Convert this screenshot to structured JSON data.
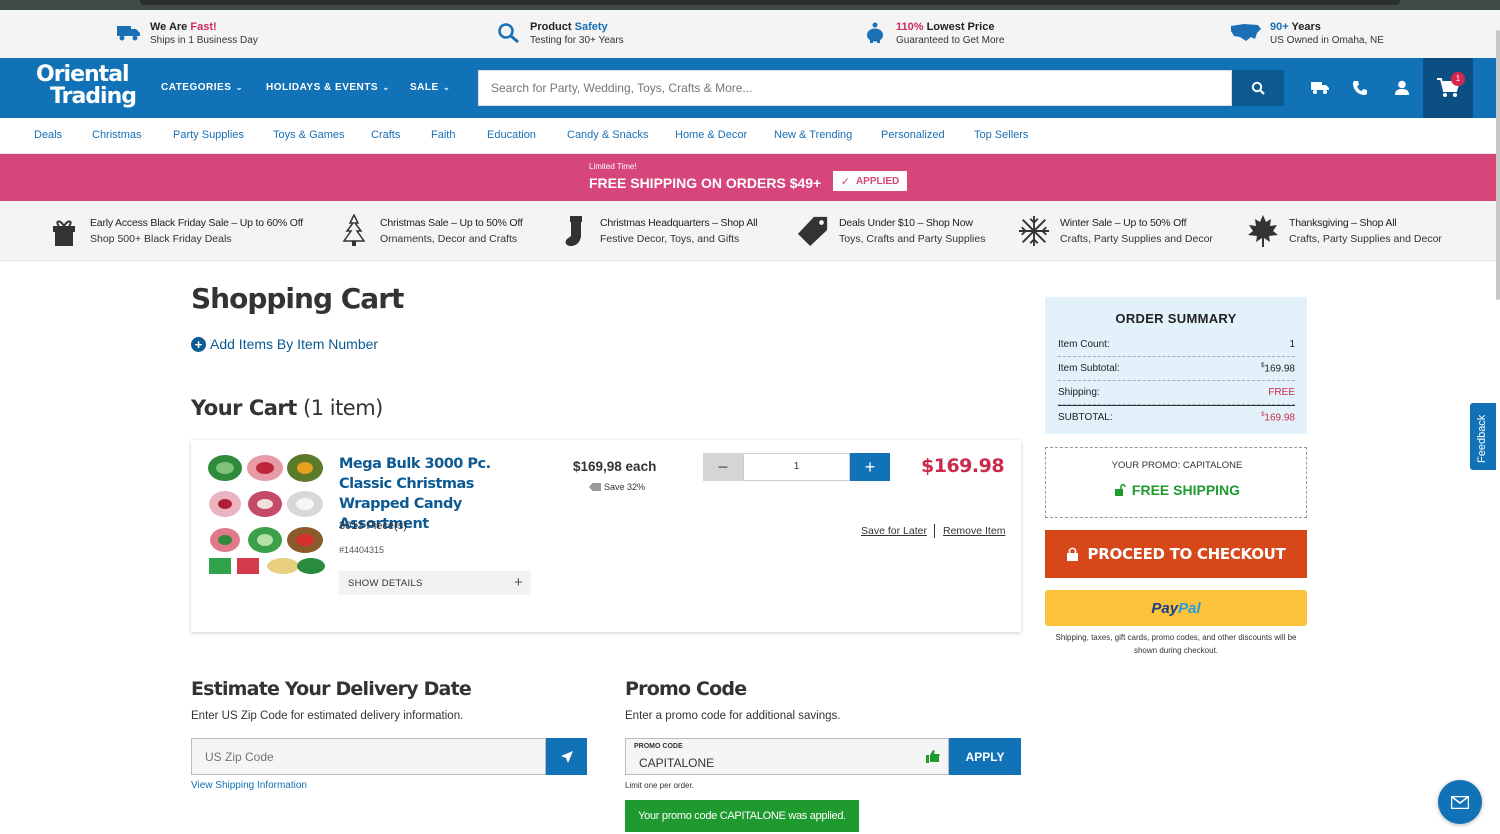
{
  "value_props": [
    {
      "title_a": "We Are ",
      "title_b": "Fast!",
      "sub": "Ships in 1 Business Day",
      "icon": "truck-icon"
    },
    {
      "title_a": "Product ",
      "title_b": "Safety",
      "sub": "Testing for 30+ Years",
      "icon": "magnifier-icon"
    },
    {
      "title_a": "110%",
      "title_b": " Lowest Price",
      "sub": "Guaranteed to Get More",
      "icon": "piggy-bank-icon"
    },
    {
      "title_a": "90+",
      "title_b": " Years",
      "sub": "US Owned in Omaha, NE",
      "icon": "usa-map-icon"
    }
  ],
  "header": {
    "logo_line1": "Oriental",
    "logo_line2": "Trading",
    "nav": [
      "CATEGORIES",
      "HOLIDAYS & EVENTS",
      "SALE"
    ],
    "search_placeholder": "Search for Party, Wedding, Toys, Crafts & More...",
    "cart_count": "1"
  },
  "category_nav": [
    "Deals",
    "Christmas",
    "Party Supplies",
    "Toys & Games",
    "Crafts",
    "Faith",
    "Education",
    "Candy & Snacks",
    "Home & Decor",
    "New & Trending",
    "Personalized",
    "Top Sellers"
  ],
  "promo_banner": {
    "small": "Limited Time!",
    "big": "FREE SHIPPING ON ORDERS $49+",
    "badge": "APPLIED"
  },
  "deals": [
    {
      "title": "Early Access Black Friday Sale – Up to 60% Off",
      "sub": "Shop 500+ Black Friday Deals",
      "icon": "gift-icon"
    },
    {
      "title": "Christmas Sale – Up to 50% Off",
      "sub": "Ornaments, Decor and Crafts",
      "icon": "christmas-tree-icon"
    },
    {
      "title": "Christmas Headquarters – Shop All",
      "sub": "Festive Decor, Toys, and Gifts",
      "icon": "stocking-icon"
    },
    {
      "title": "Deals Under $10 – Shop Now",
      "sub": "Toys, Crafts and Party Supplies",
      "icon": "price-tag-icon"
    },
    {
      "title": "Winter Sale – Up to 50% Off",
      "sub": "Crafts, Party Supplies and Decor",
      "icon": "snowflake-icon"
    },
    {
      "title": "Thanksgiving – Shop All",
      "sub": "Crafts, Party Supplies and Decor",
      "icon": "maple-leaf-icon"
    }
  ],
  "page": {
    "title": "Shopping Cart",
    "add_items": "Add Items By Item Number",
    "your_cart": "Your Cart",
    "item_count_text": "(1 item)"
  },
  "cart_item": {
    "name": "Mega Bulk 3000 Pc. Classic Christmas Wrapped Candy Assortment",
    "pieces": "3013 Piece(s)",
    "sku": "#14404315",
    "show_details": "SHOW DETAILS",
    "price_each": "$169,98 each",
    "save": "Save 32%",
    "quantity": "1",
    "total": "$169.98",
    "save_for_later": "Save for Later",
    "remove": "Remove Item"
  },
  "delivery": {
    "title": "Estimate Your Delivery Date",
    "sub": "Enter US Zip Code for estimated delivery information.",
    "placeholder": "US Zip Code",
    "link": "View Shipping Information"
  },
  "promo_code": {
    "title": "Promo Code",
    "sub": "Enter a promo code for additional savings.",
    "label": "PROMO CODE",
    "value": "CAPITALONE",
    "apply": "APPLY",
    "limit": "Limit one per order.",
    "success": "Your promo code CAPITALONE was applied."
  },
  "summary": {
    "title": "ORDER SUMMARY",
    "rows": [
      {
        "label": "Item Count:",
        "value": "1"
      },
      {
        "label": "Item Subtotal:",
        "value_sup": "$",
        "value": "169.98"
      },
      {
        "label": "Shipping:",
        "value": "FREE"
      },
      {
        "label": "SUBTOTAL:",
        "value_sup": "$",
        "value": "169.98"
      }
    ],
    "your_promo": "YOUR PROMO: CAPITALONE",
    "free_shipping": "FREE SHIPPING",
    "checkout": "PROCEED TO CHECKOUT",
    "paypal_a": "Pay",
    "paypal_b": "Pal",
    "note": "Shipping, taxes, gift cards, promo codes, and other discounts will be shown during checkout."
  },
  "feedback": "Feedback",
  "colors": {
    "brand_blue": "#1272b8",
    "promo_pink": "#d6467a",
    "checkout_orange": "#d6471a",
    "success_green": "#1f9a2e",
    "price_red": "#cc2a4a"
  }
}
